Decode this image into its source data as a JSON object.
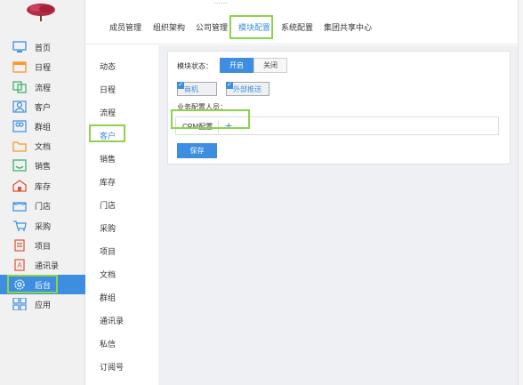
{
  "colors": {
    "accent": "#3d8ee0",
    "highlight": "#8dd34a"
  },
  "top_strip": "……",
  "app_sidebar": {
    "items": [
      {
        "label": "首页",
        "icon": "monitor-icon"
      },
      {
        "label": "日程",
        "icon": "calendar-icon"
      },
      {
        "label": "流程",
        "icon": "flow-icon"
      },
      {
        "label": "客户",
        "icon": "customer-icon"
      },
      {
        "label": "群组",
        "icon": "group-icon"
      },
      {
        "label": "文档",
        "icon": "folder-icon"
      },
      {
        "label": "销售",
        "icon": "sales-icon"
      },
      {
        "label": "库存",
        "icon": "warehouse-icon"
      },
      {
        "label": "门店",
        "icon": "store-icon"
      },
      {
        "label": "采购",
        "icon": "cart-icon"
      },
      {
        "label": "项目",
        "icon": "project-icon"
      },
      {
        "label": "通讯录",
        "icon": "contacts-icon"
      },
      {
        "label": "后台",
        "icon": "settings-icon",
        "active": true
      },
      {
        "label": "应用",
        "icon": "apps-icon"
      }
    ]
  },
  "top_nav": {
    "tabs": [
      {
        "label": "成员管理"
      },
      {
        "label": "组织架构"
      },
      {
        "label": "公司管理"
      },
      {
        "label": "模块配置",
        "active": true
      },
      {
        "label": "系统配置"
      },
      {
        "label": "集团共享中心"
      }
    ]
  },
  "sub_nav": {
    "items": [
      {
        "label": "动态"
      },
      {
        "label": "日程"
      },
      {
        "label": "流程"
      },
      {
        "label": "客户",
        "active": true
      },
      {
        "label": "销售"
      },
      {
        "label": "库存"
      },
      {
        "label": "门店"
      },
      {
        "label": "采购"
      },
      {
        "label": "项目"
      },
      {
        "label": "文档"
      },
      {
        "label": "群组"
      },
      {
        "label": "通讯录"
      },
      {
        "label": "私信"
      },
      {
        "label": "订阅号"
      }
    ]
  },
  "config": {
    "module_status_label": "模块状态：",
    "toggle_on": "开启",
    "toggle_off": "关闭",
    "toggle_value": "开启",
    "checkboxes": [
      {
        "label": "商机",
        "checked": true
      },
      {
        "label": "外部推送",
        "checked": true
      }
    ],
    "members_label": "业务配置人员：",
    "member_chip": "CRM配置",
    "add_icon": "plus-icon",
    "save_label": "保存"
  }
}
